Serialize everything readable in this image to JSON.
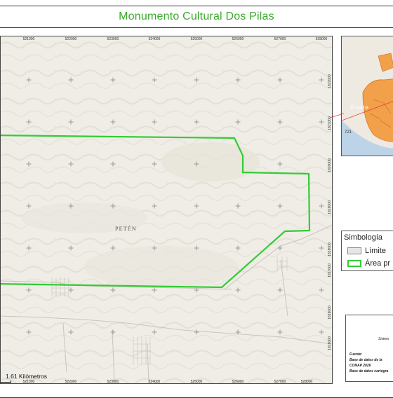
{
  "title": "Monumento Cultural Dos Pilas",
  "map": {
    "region_label": "PETÉN",
    "scale_label": "1.61 Kilómetros",
    "x_ticks": [
      "521000",
      "522000",
      "523000",
      "524000",
      "525000",
      "526000",
      "527000",
      "528000"
    ],
    "x_ticks_bottom": [
      "521000",
      "522000",
      "523000",
      "524000",
      "525000",
      "526000",
      "527000",
      "528000"
    ],
    "y_ticks": [
      "1822000",
      "1821000",
      "1820000",
      "1819000",
      "1818000",
      "1817000",
      "1816000",
      "1815000"
    ],
    "protected_area_color": "#33cc33",
    "basemap_color": "#efede6"
  },
  "inset": {
    "country_label": "Guate",
    "road_label": "721",
    "fill_color": "#f2a04a",
    "pointer_color": "#e0382f"
  },
  "legend": {
    "title": "Simbología",
    "items": [
      {
        "label": "Límite",
        "type": "limit"
      },
      {
        "label": "Área pr",
        "type": "area"
      }
    ]
  },
  "info": {
    "system_label": "Sistem",
    "fuente_label": "Fuente:",
    "lines": [
      "Base de datos de la",
      "CONAP 2026",
      "Base de datos cartogra"
    ]
  }
}
